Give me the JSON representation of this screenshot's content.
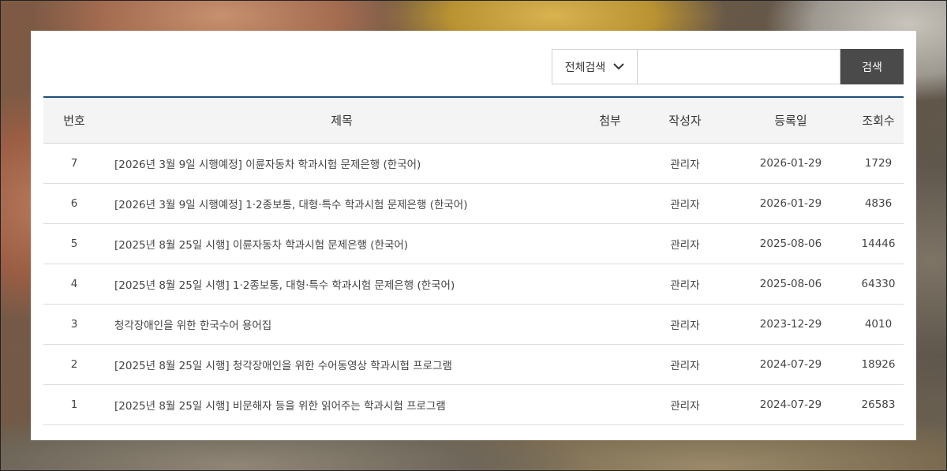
{
  "search": {
    "scope_label": "전체검색",
    "query": "",
    "placeholder": "",
    "button_label": "검색"
  },
  "table": {
    "headers": {
      "no": "번호",
      "title": "제목",
      "attachment": "첨부",
      "author": "작성자",
      "date": "등록일",
      "views": "조회수"
    },
    "rows": [
      {
        "no": "7",
        "title": "[2026년 3월 9일 시행예정] 이륜자동차 학과시험 문제은행 (한국어)",
        "attachment": "",
        "author": "관리자",
        "date": "2026-01-29",
        "views": "1729"
      },
      {
        "no": "6",
        "title": "[2026년 3월 9일 시행예정] 1·2종보통, 대형·특수 학과시험 문제은행 (한국어)",
        "attachment": "",
        "author": "관리자",
        "date": "2026-01-29",
        "views": "4836"
      },
      {
        "no": "5",
        "title": "[2025년 8월 25일 시행] 이륜자동차 학과시험 문제은행 (한국어)",
        "attachment": "",
        "author": "관리자",
        "date": "2025-08-06",
        "views": "14446"
      },
      {
        "no": "4",
        "title": "[2025년 8월 25일 시행] 1·2종보통, 대형·특수 학과시험 문제은행 (한국어)",
        "attachment": "",
        "author": "관리자",
        "date": "2025-08-06",
        "views": "64330"
      },
      {
        "no": "3",
        "title": "청각장애인을 위한 한국수어 용어집",
        "attachment": "",
        "author": "관리자",
        "date": "2023-12-29",
        "views": "4010"
      },
      {
        "no": "2",
        "title": "[2025년 8월 25일 시행] 청각장애인을 위한 수어동영상 학과시험 프로그램",
        "attachment": "",
        "author": "관리자",
        "date": "2024-07-29",
        "views": "18926"
      },
      {
        "no": "1",
        "title": "[2025년 8월 25일 시행] 비문해자 등을 위한 읽어주는 학과시험 프로그램",
        "attachment": "",
        "author": "관리자",
        "date": "2024-07-29",
        "views": "26583"
      }
    ]
  },
  "colors": {
    "header_border": "#1f4e79",
    "search_button": "#4a4a4a",
    "header_bg": "#f4f4f4"
  }
}
